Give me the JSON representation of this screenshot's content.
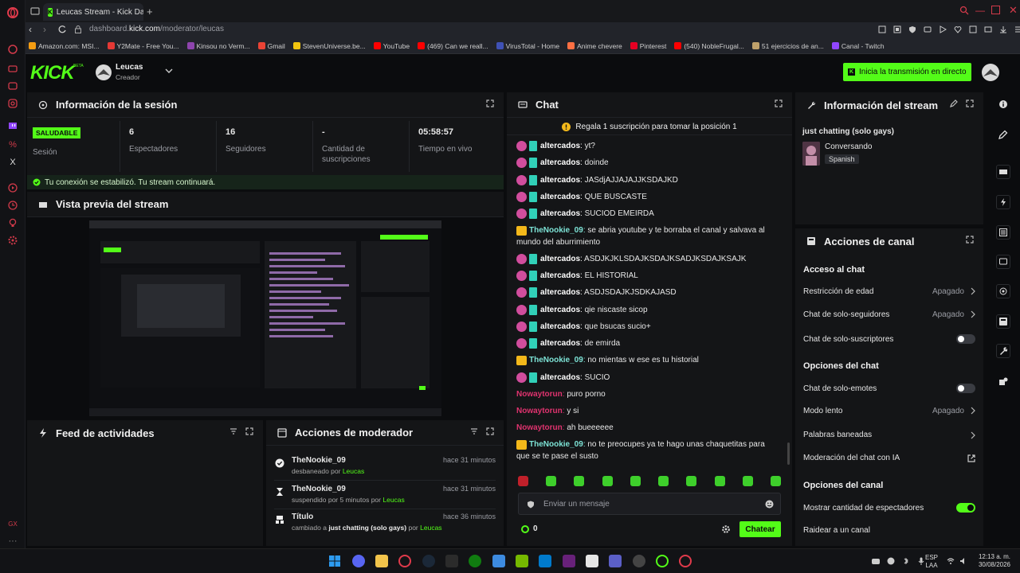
{
  "browser": {
    "tab_title": "Leucas Stream - Kick Dashb",
    "url_prefix": "dashboard.",
    "url_domain": "kick.com",
    "url_path": "/moderator/leucas",
    "bookmarks": [
      {
        "label": "Amazon.com: MSI...",
        "color": "#f39c12"
      },
      {
        "label": "Y2Mate - Free You...",
        "color": "#e53935"
      },
      {
        "label": "Kinsou no Verm...",
        "color": "#8e44ad"
      },
      {
        "label": "Gmail",
        "color": "#ea4335"
      },
      {
        "label": "StevenUniverse.be...",
        "color": "#f1c40f"
      },
      {
        "label": "YouTube",
        "color": "#ff0000"
      },
      {
        "label": "(469) Can we reall...",
        "color": "#ff0000"
      },
      {
        "label": "VirusTotal - Home",
        "color": "#3f51b5"
      },
      {
        "label": "Anime chevere",
        "color": "#ff7043"
      },
      {
        "label": "Pinterest",
        "color": "#e60023"
      },
      {
        "label": "(540) NobleFrugal...",
        "color": "#ff0000"
      },
      {
        "label": "51 ejercicios de an...",
        "color": "#bfa16b"
      },
      {
        "label": "Canal - Twitch",
        "color": "#9146ff"
      }
    ]
  },
  "header": {
    "logo": "KICK",
    "logo_beta": "BETA",
    "user_name": "Leucas",
    "user_role": "Creador",
    "go_live_label": "Inicia la transmisión en directo"
  },
  "session": {
    "title": "Información de la sesión",
    "status_badge": "SALUDABLE",
    "status_label": "Sesión",
    "stats": [
      {
        "value": "6",
        "label": "Espectadores"
      },
      {
        "value": "16",
        "label": "Seguidores"
      },
      {
        "value": "-",
        "label": "Cantidad de suscripciones"
      },
      {
        "value": "05:58:57",
        "label": "Tiempo en vivo"
      }
    ],
    "connection_msg": "Tu conexión se estabilizó. Tu stream continuará."
  },
  "preview": {
    "title": "Vista previa del stream"
  },
  "activity": {
    "title": "Feed de actividades"
  },
  "mod_actions": {
    "title": "Acciones de moderador",
    "items": [
      {
        "user": "TheNookie_09",
        "time": "hace 31 minutos",
        "action": "desbaneado por",
        "by": "Leucas",
        "icon": "check-circle-icon"
      },
      {
        "user": "TheNookie_09",
        "time": "hace 31 minutos",
        "action": "suspendido por 5 minutos por",
        "by": "Leucas",
        "icon": "hourglass-icon"
      },
      {
        "user": "Título",
        "time": "hace 36 minutos",
        "action": "cambiado a",
        "subject": "just chatting (solo gays)",
        "action2": "por",
        "by": "Leucas",
        "icon": "people-icon"
      }
    ]
  },
  "chat": {
    "title": "Chat",
    "pinned": "Regala 1 suscripción para tomar la posición 1",
    "messages": [
      {
        "user": "altercados",
        "text": "yt?",
        "color": "#ffffff",
        "badges": "mod"
      },
      {
        "user": "altercados",
        "text": "doinde",
        "color": "#ffffff",
        "badges": "mod"
      },
      {
        "user": "altercados",
        "text": "JASdjAJJAJAJJKSDAJKD",
        "color": "#ffffff",
        "badges": "mod"
      },
      {
        "user": "altercados",
        "text": "QUE BUSCASTE",
        "color": "#ffffff",
        "badges": "mod"
      },
      {
        "user": "altercados",
        "text": "SUCIOD EMEIRDA",
        "color": "#ffffff",
        "badges": "mod"
      },
      {
        "user": "TheNookie_09",
        "text": "se abria youtube y te borraba el canal y salvava al mundo del aburrimiento",
        "color": "#7de3d6",
        "badges": "crown"
      },
      {
        "user": "altercados",
        "text": "ASDJKJKLSDAJKSDAJKSADJKSDAJKSAJK",
        "color": "#ffffff",
        "badges": "mod"
      },
      {
        "user": "altercados",
        "text": "EL HISTORIAL",
        "color": "#ffffff",
        "badges": "mod"
      },
      {
        "user": "altercados",
        "text": "ASDJSDAJKJSDKAJASD",
        "color": "#ffffff",
        "badges": "mod"
      },
      {
        "user": "altercados",
        "text": "qie niscaste sicop",
        "color": "#ffffff",
        "badges": "mod"
      },
      {
        "user": "altercados",
        "text": "que bsucas sucio+",
        "color": "#ffffff",
        "badges": "mod"
      },
      {
        "user": "altercados",
        "text": "de emirda",
        "color": "#ffffff",
        "badges": "mod"
      },
      {
        "user": "TheNookie_09",
        "text": "no mientas w ese es tu historial",
        "color": "#7de3d6",
        "badges": "crown"
      },
      {
        "user": "altercados",
        "text": "SUCIO",
        "color": "#ffffff",
        "badges": "mod"
      },
      {
        "user": "Nowaytorun",
        "text": "puro porno",
        "color": "#e0336f",
        "badges": ""
      },
      {
        "user": "Nowaytorun",
        "text": "y si",
        "color": "#e0336f",
        "badges": ""
      },
      {
        "user": "Nowaytorun",
        "text": "ah bueeeeee",
        "color": "#e0336f",
        "badges": ""
      },
      {
        "user": "TheNookie_09",
        "text": "no te preocupes ya te hago unas chaquetitas para que se te pase el susto",
        "color": "#7de3d6",
        "badges": "crown"
      }
    ],
    "input_placeholder": "Enviar un mensaje",
    "points": "0",
    "send_label": "Chatear"
  },
  "stream_info": {
    "title": "Información del stream",
    "stream_title": "just chatting (solo gays)",
    "category": "Conversando",
    "language": "Spanish"
  },
  "channel_actions": {
    "title": "Acciones de canal",
    "chat_access_title": "Acceso al chat",
    "age_restriction": {
      "label": "Restricción de edad",
      "value": "Apagado"
    },
    "followers_only": {
      "label": "Chat de solo-seguidores",
      "value": "Apagado"
    },
    "subs_only": {
      "label": "Chat de solo-suscriptores",
      "on": false
    },
    "chat_options_title": "Opciones del chat",
    "emotes_only": {
      "label": "Chat de solo-emotes",
      "on": false
    },
    "slow_mode": {
      "label": "Modo lento",
      "value": "Apagado"
    },
    "banned_words": {
      "label": "Palabras baneadas"
    },
    "ai_moderation": {
      "label": "Moderación del chat con IA"
    },
    "channel_options_title": "Opciones del canal",
    "show_viewers": {
      "label": "Mostrar cantidad de espectadores",
      "on": true
    },
    "raid": {
      "label": "Raidear a un canal"
    }
  },
  "taskbar": {
    "lang": "ESP",
    "lang2": "LAA",
    "time": "12:13 a. m.",
    "date": "30/08/2026"
  }
}
